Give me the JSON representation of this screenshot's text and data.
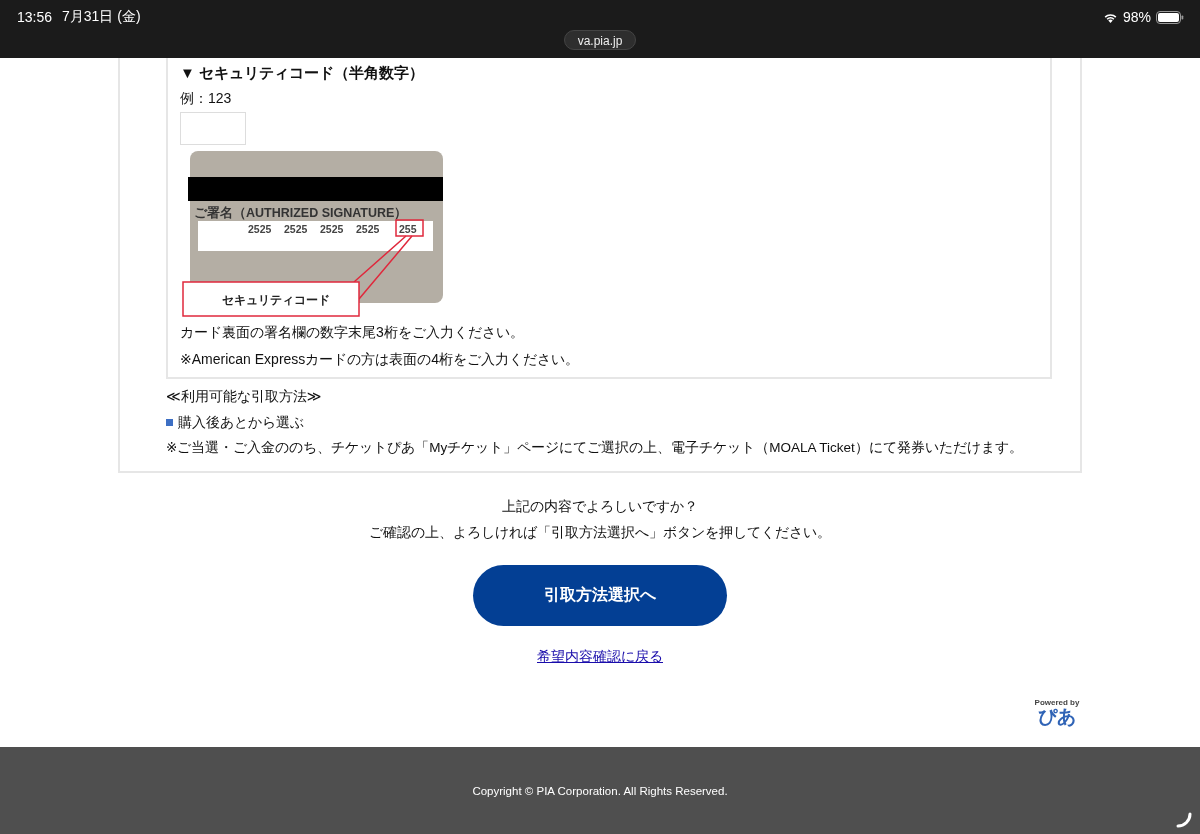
{
  "status_bar": {
    "time": "13:56",
    "date": "7月31日 (金)",
    "battery": "98%"
  },
  "address_bar": {
    "url": "va.pia.jp"
  },
  "security_code": {
    "heading": "▼ セキュリティコード（半角数字）",
    "example": "例：123",
    "card_illustration": {
      "signature_label": "ご署名（AUTHRIZED SIGNATURE）",
      "numbers": [
        "2525",
        "2525",
        "2525",
        "2525"
      ],
      "code": "255",
      "callout": "セキュリティコード"
    },
    "notes": [
      "カード裏面の署名欄の数字末尾3桁をご入力ください。",
      "※American Expressカードの方は表面の4桁をご入力ください。"
    ]
  },
  "pickup": {
    "heading": "≪利用可能な引取方法≫",
    "options": [
      {
        "label": "購入後あとから選ぶ"
      }
    ],
    "note": "※ご当選・ご入金ののち、チケットぴあ「Myチケット」ページにてご選択の上、電子チケット（MOALA Ticket）にて発券いただけます。"
  },
  "confirm": {
    "lines": [
      "上記の内容でよろしいですか？",
      "ご確認の上、よろしければ「引取方法選択へ」ボタンを押してください。"
    ],
    "button": "引取方法選択へ",
    "back_link": "希望内容確認に戻る"
  },
  "powered_by": {
    "label": "Powered by",
    "logo": "ぴあ"
  },
  "footer": {
    "copyright": "Copyright © PIA Corporation. All Rights Reserved."
  }
}
